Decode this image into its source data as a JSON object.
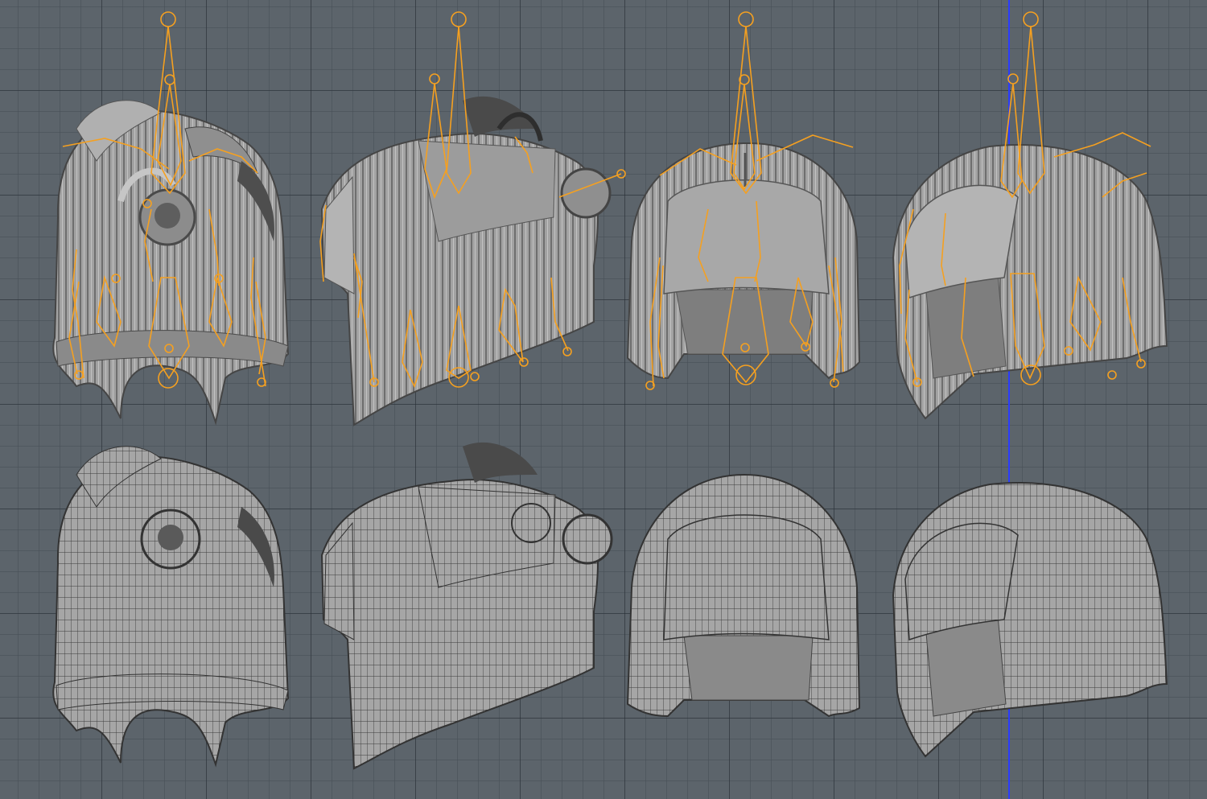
{
  "viewport": {
    "background_color": "#5c646b",
    "grid_line_color": "#3c444b",
    "axis_line_color": "#2a3cff",
    "view": "orthographic-front"
  },
  "colors": {
    "mesh_fill": "#9a9a9a",
    "mesh_light": "#b3b3b3",
    "mesh_dark": "#4a4a4a",
    "wire": "#333333",
    "bone": "#f5a020"
  },
  "models": [
    {
      "id": "hair-1",
      "style": "top-knot",
      "display": "solid-with-armature"
    },
    {
      "id": "hair-2",
      "style": "side-buns",
      "display": "solid-with-armature"
    },
    {
      "id": "hair-3",
      "style": "bob-with-bangs",
      "display": "solid-with-armature"
    },
    {
      "id": "hair-4",
      "style": "bob-side-bangs",
      "display": "solid-with-armature"
    },
    {
      "id": "hair-5",
      "style": "top-knot",
      "display": "wireframe"
    },
    {
      "id": "hair-6",
      "style": "side-buns",
      "display": "wireframe"
    },
    {
      "id": "hair-7",
      "style": "bob-with-bangs",
      "display": "wireframe"
    },
    {
      "id": "hair-8",
      "style": "bob-side-bangs",
      "display": "wireframe"
    }
  ]
}
